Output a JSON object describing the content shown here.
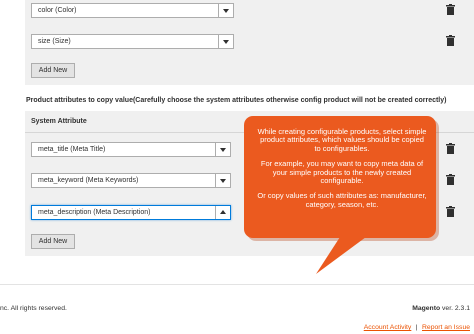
{
  "attributes_section": {
    "rows": [
      {
        "value": "color (Color)"
      },
      {
        "value": "size (Size)"
      }
    ],
    "add_new_label": "Add New"
  },
  "copy_section": {
    "title": "Product attributes to copy value(Carefully choose the system attributes otherwise config product will not be created correctly)",
    "column_header": "System Attribute",
    "rows": [
      {
        "value": "meta_title (Meta Title)"
      },
      {
        "value": "meta_keyword (Meta Keywords)"
      },
      {
        "value": "meta_description (Meta Description)"
      }
    ],
    "add_new_label": "Add New"
  },
  "callout": {
    "paragraphs": [
      "While creating configurable products, select simple product attributes, which values should be copied to configurables.",
      "For example, you may want to copy meta data of your simple products to the newly created configurable.",
      "Or copy values of such attributes as: manufacturer, category, season, etc."
    ],
    "color": "#eb5a1f"
  },
  "footer": {
    "copyright": "nc. All rights reserved.",
    "brand": "Magento",
    "version": "ver. 2.3.1",
    "account_activity": "Account Activity",
    "separator": "|",
    "report_issue": "Report an Issue"
  },
  "icons": {
    "trash": "trash-icon",
    "dropdown": "chevron-down-icon",
    "dropup": "chevron-up-icon"
  }
}
